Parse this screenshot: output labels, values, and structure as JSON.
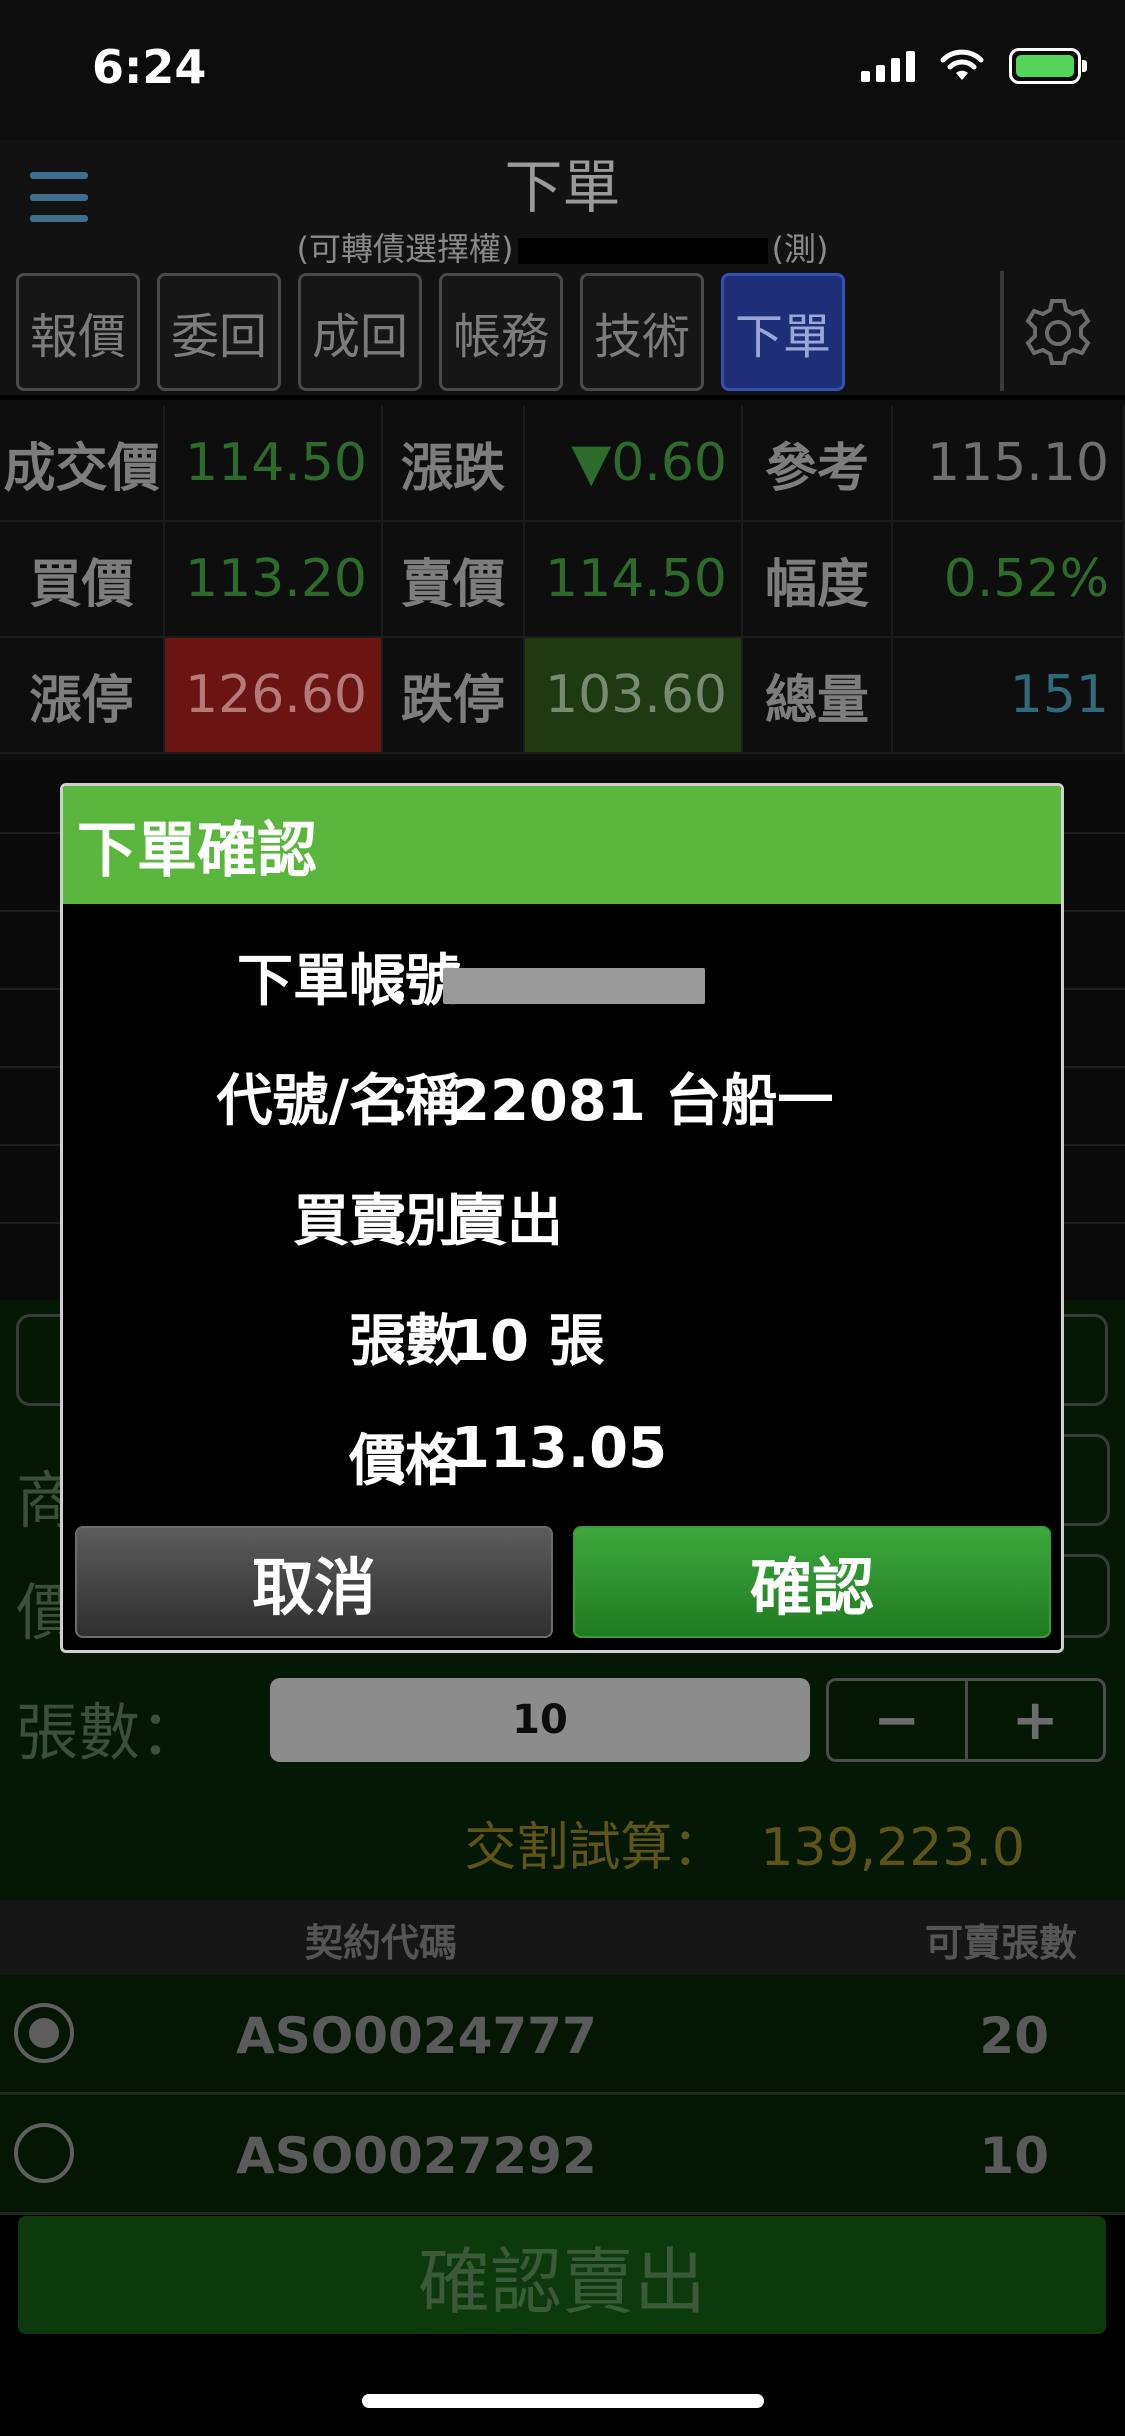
{
  "status_bar": {
    "time": "6:24"
  },
  "header": {
    "title": "下單",
    "subtitle_prefix": "(可轉債選擇權)",
    "subtitle_suffix": "(測)"
  },
  "tabs": [
    {
      "label": "報價"
    },
    {
      "label": "委回"
    },
    {
      "label": "成回"
    },
    {
      "label": "帳務"
    },
    {
      "label": "技術"
    },
    {
      "label": "下單",
      "active": true
    }
  ],
  "quote": {
    "last_label": "成交價",
    "last_value": "114.50",
    "change_label": "漲跌",
    "change_value": "▼0.60",
    "ref_label": "參考",
    "ref_value": "115.10",
    "bid_label": "買價",
    "bid_value": "113.20",
    "ask_label": "賣價",
    "ask_value": "114.50",
    "pct_label": "幅度",
    "pct_value": "0.52%",
    "limit_up_label": "漲停",
    "limit_up_value": "126.60",
    "limit_down_label": "跌停",
    "limit_down_value": "103.60",
    "volume_label": "總量",
    "volume_value": "151"
  },
  "form": {
    "product_label_partial": "商",
    "price_label_partial": "價",
    "qty_label": "張數：",
    "qty_value": "10",
    "minus": "−",
    "plus": "+",
    "estimate_label": "交割試算：",
    "estimate_value": "139,223.0"
  },
  "contract_list": {
    "header_code": "契約代碼",
    "header_qty": "可賣張數",
    "rows": [
      {
        "code": "ASO0024777",
        "qty": "20",
        "selected": true
      },
      {
        "code": "ASO0027292",
        "qty": "10",
        "selected": false
      }
    ]
  },
  "submit_label": "確認賣出",
  "dialog": {
    "title": "下單確認",
    "separator": "：",
    "fields": [
      {
        "label": "下單帳號",
        "value": ""
      },
      {
        "label": "代號/名稱",
        "value": "22081 台船一"
      },
      {
        "label": "買賣別",
        "value": "賣出"
      },
      {
        "label": "張數",
        "value": "10 張"
      },
      {
        "label": "價格",
        "value": "113.05"
      }
    ],
    "cancel_label": "取消",
    "confirm_label": "確認"
  },
  "colors": {
    "dialog_header": "#5bb63d",
    "confirm_button": "#2e8f2e",
    "active_tab": "#1e2f78",
    "limit_up_bg": "#6a1414",
    "limit_down_bg": "#1f3a12"
  },
  "icons": [
    "menu-icon",
    "cell-signal-icon",
    "wifi-icon",
    "battery-icon",
    "gear-icon",
    "radio-checked-icon",
    "radio-unchecked-icon"
  ]
}
